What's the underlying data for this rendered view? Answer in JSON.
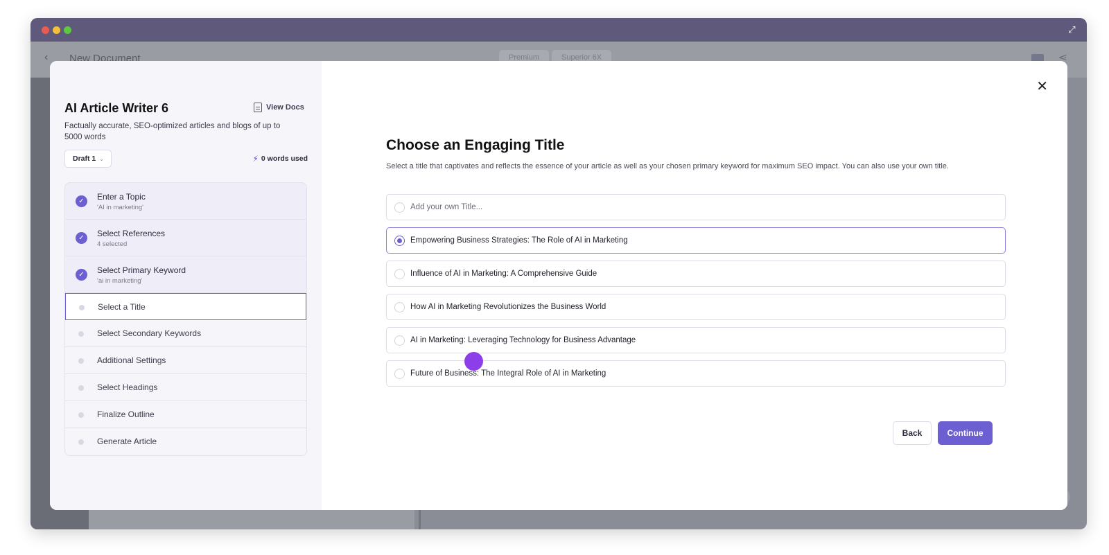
{
  "background": {
    "document_title": "New Document",
    "tabs": [
      "Premium",
      "Superior 6X"
    ]
  },
  "tool": {
    "title": "AI Article Writer 6",
    "view_docs": "View Docs",
    "description": "Factually accurate, SEO-optimized articles and blogs of up to 5000 words",
    "draft": "Draft 1",
    "words_used": "0 words used"
  },
  "steps": [
    {
      "label": "Enter a Topic",
      "sub": "'AI in marketing'",
      "state": "done"
    },
    {
      "label": "Select References",
      "sub": "4 selected",
      "state": "done"
    },
    {
      "label": "Select Primary Keyword",
      "sub": "'ai in marketing'",
      "state": "done"
    },
    {
      "label": "Select a Title",
      "sub": "",
      "state": "active"
    },
    {
      "label": "Select Secondary Keywords",
      "sub": "",
      "state": "pending"
    },
    {
      "label": "Additional Settings",
      "sub": "",
      "state": "pending"
    },
    {
      "label": "Select Headings",
      "sub": "",
      "state": "pending"
    },
    {
      "label": "Finalize Outline",
      "sub": "",
      "state": "pending"
    },
    {
      "label": "Generate Article",
      "sub": "",
      "state": "pending"
    }
  ],
  "main": {
    "heading": "Choose an Engaging Title",
    "description": "Select a title that captivates and reflects the essence of your article as well as your chosen primary keyword for maximum SEO impact. You can also use your own title.",
    "own_title_placeholder": "Add your own Title...",
    "options": [
      "Empowering Business Strategies: The Role of AI in Marketing",
      "Influence of AI in Marketing: A Comprehensive Guide",
      "How AI in Marketing Revolutionizes the Business World",
      "AI in Marketing: Leveraging Technology for Business Advantage",
      "Future of Business: The Integral Role of AI in Marketing"
    ],
    "selected_index": 0,
    "back_label": "Back",
    "continue_label": "Continue"
  },
  "colors": {
    "accent": "#6b5fd1",
    "cursor": "#8c3ee8"
  }
}
